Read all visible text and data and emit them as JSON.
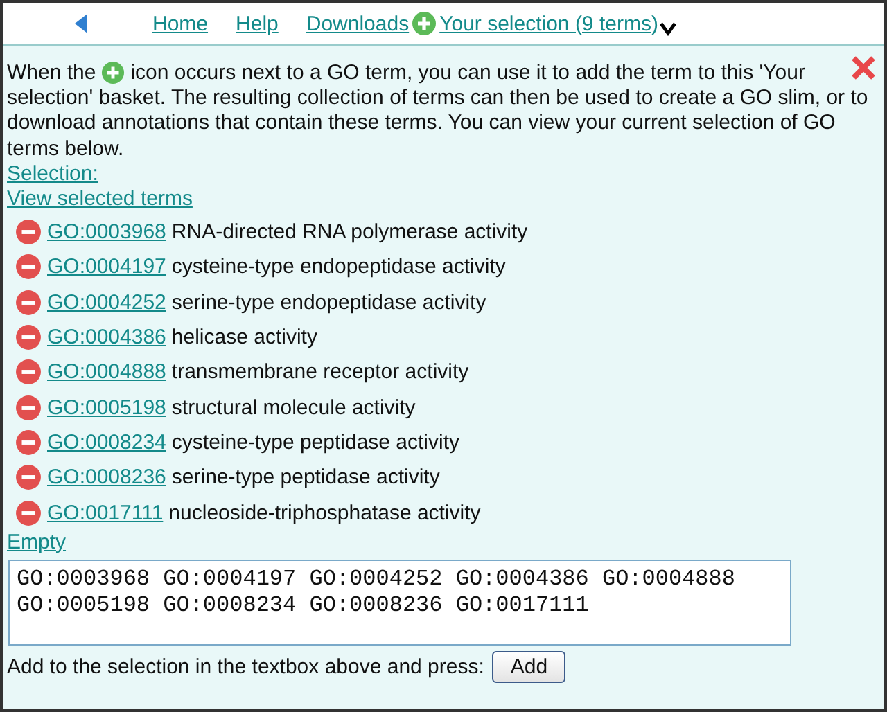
{
  "nav": {
    "links": [
      "Home",
      "Help",
      "Downloads"
    ],
    "selection_link": "Your selection (9 terms)"
  },
  "intro": {
    "before_icon": "When the",
    "after_icon": "icon occurs next to a GO term, you can use it to add the term to this 'Your",
    "rest": "selection' basket. The resulting collection of terms can then be used to create a GO slim, or to download annotations that contain these terms. You can view your current selection of GO terms below."
  },
  "selection_link": "Selection:",
  "view_link": "View selected terms",
  "terms": [
    {
      "id": "GO:0003968",
      "name": "RNA-directed RNA polymerase activity"
    },
    {
      "id": "GO:0004197",
      "name": "cysteine-type endopeptidase activity"
    },
    {
      "id": "GO:0004252",
      "name": "serine-type endopeptidase activity"
    },
    {
      "id": "GO:0004386",
      "name": "helicase activity"
    },
    {
      "id": "GO:0004888",
      "name": "transmembrane receptor activity"
    },
    {
      "id": "GO:0005198",
      "name": "structural molecule activity"
    },
    {
      "id": "GO:0008234",
      "name": "cysteine-type peptidase activity"
    },
    {
      "id": "GO:0008236",
      "name": "serine-type peptidase activity"
    },
    {
      "id": "GO:0017111",
      "name": "nucleoside-triphosphatase activity"
    }
  ],
  "empty_link": "Empty",
  "textbox": {
    "value": "GO:0003968 GO:0004197 GO:0004252 GO:0004386 GO:0004888 GO:0005198 GO:0008234 GO:0008236 GO:0017111"
  },
  "add_prompt": "Add to the selection in the textbox above and press:",
  "add_button": "Add"
}
